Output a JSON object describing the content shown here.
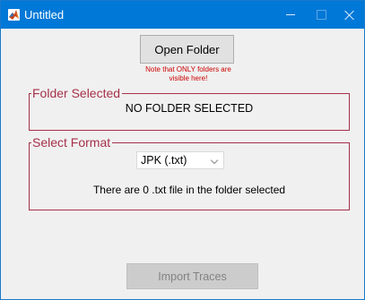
{
  "window": {
    "title": "Untitled",
    "accent_color": "#0078d7",
    "icon": "matlab-icon"
  },
  "main": {
    "open_folder_label": "Open Folder",
    "note_line1": "Note that ONLY folders are",
    "note_line2": "visible here!",
    "note_color": "#cc0000",
    "folder_panel": {
      "title": "Folder Selected",
      "status": "NO FOLDER SELECTED"
    },
    "format_panel": {
      "title": "Select Format",
      "selected_format": "JPK (.txt)",
      "file_count_text": "There are 0 .txt file in the folder selected"
    },
    "panel_border_color": "#a6314a",
    "import_label": "Import Traces",
    "import_enabled": false
  }
}
